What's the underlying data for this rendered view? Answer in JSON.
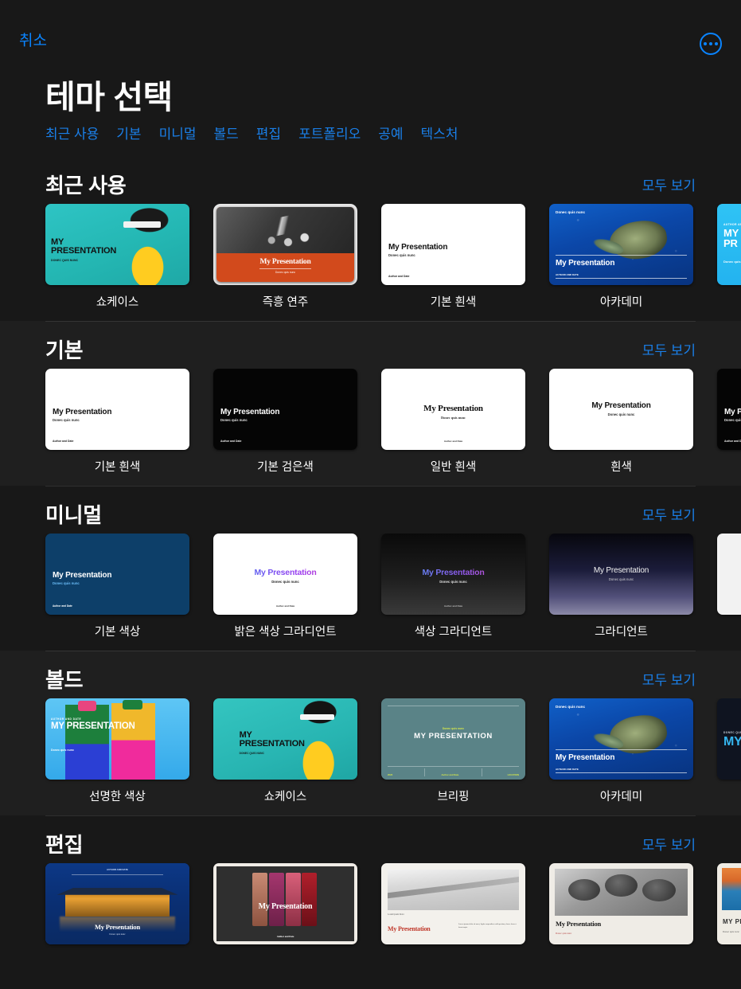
{
  "topbar": {
    "cancel_label": "취소",
    "more_icon": "ellipsis-circle-icon",
    "accent_color": "#0a84ff"
  },
  "page_title": "테마 선택",
  "categories": [
    {
      "label": "최근 사용"
    },
    {
      "label": "기본"
    },
    {
      "label": "미니멀"
    },
    {
      "label": "볼드"
    },
    {
      "label": "편집"
    },
    {
      "label": "포트폴리오"
    },
    {
      "label": "공예"
    },
    {
      "label": "텍스처"
    }
  ],
  "see_all_label": "모두 보기",
  "slide_text": {
    "title_en": "My Presentation",
    "title_caps": "MY PRESENTATION",
    "subtitle": "Donec quis nunc",
    "subtitle_caps": "DONEC QUIS NUNC",
    "author_date": "Author and Date",
    "author_date_caps": "AUTHOR AND DATE",
    "lorem_caption": "Lorem Ipsum Dolor",
    "lorem_body": "Lorem ipsum dolor sit amet, ligula suspendisse nulla pretium, donec laoreet lacus turpis.",
    "briefing_left": "2022",
    "briefing_right": "LOCATION"
  },
  "sections": [
    {
      "title": "최근 사용",
      "see_all": "모두 보기",
      "themes": [
        {
          "name": "쇼케이스",
          "style": "showcase"
        },
        {
          "name": "즉흥 연주",
          "style": "improv",
          "selected": true
        },
        {
          "name": "기본 흰색",
          "style": "white"
        },
        {
          "name": "아카데미",
          "style": "academy"
        },
        {
          "name": "",
          "style": "cyan",
          "partial": true
        }
      ]
    },
    {
      "title": "기본",
      "see_all": "모두 보기",
      "themes": [
        {
          "name": "기본 흰색",
          "style": "white"
        },
        {
          "name": "기본 검은색",
          "style": "black"
        },
        {
          "name": "일반 흰색",
          "style": "classic"
        },
        {
          "name": "흰색",
          "style": "plainwhite"
        },
        {
          "name": "",
          "style": "black",
          "partial": true
        }
      ]
    },
    {
      "title": "미니멀",
      "see_all": "모두 보기",
      "themes": [
        {
          "name": "기본 색상",
          "style": "navy"
        },
        {
          "name": "밝은 색상 그라디언트",
          "style": "lightgrad"
        },
        {
          "name": "색상 그라디언트",
          "style": "darkgrad"
        },
        {
          "name": "그라디언트",
          "style": "gradient"
        },
        {
          "name": "",
          "style": "lightpartial",
          "partial": true
        }
      ]
    },
    {
      "title": "볼드",
      "see_all": "모두 보기",
      "themes": [
        {
          "name": "선명한 색상",
          "style": "vivid"
        },
        {
          "name": "쇼케이스",
          "style": "bshowcase"
        },
        {
          "name": "브리핑",
          "style": "briefing"
        },
        {
          "name": "아카데미",
          "style": "academy"
        },
        {
          "name": "",
          "style": "boldpartial",
          "partial": true
        }
      ]
    },
    {
      "title": "편집",
      "see_all": "모두 보기",
      "themes": [
        {
          "name": "",
          "style": "opera"
        },
        {
          "name": "",
          "style": "lipstick"
        },
        {
          "name": "",
          "style": "bridge"
        },
        {
          "name": "",
          "style": "kids"
        },
        {
          "name": "",
          "style": "editpartial",
          "partial": true
        }
      ]
    }
  ]
}
